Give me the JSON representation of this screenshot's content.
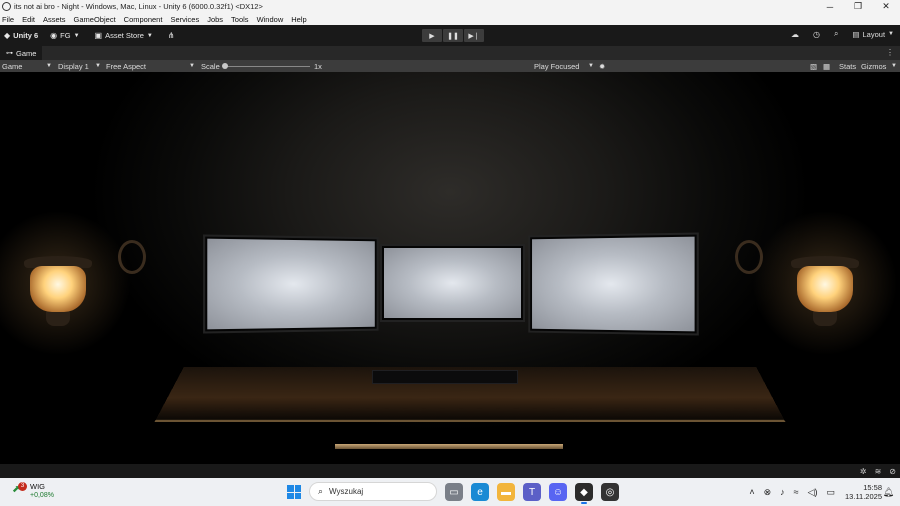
{
  "window": {
    "title": "its not ai bro - Night - Windows, Mac, Linux - Unity 6 (6000.0.32f1) <DX12>",
    "controls": [
      "─",
      "❐",
      "✕"
    ]
  },
  "menu": [
    "File",
    "Edit",
    "Assets",
    "GameObject",
    "Component",
    "Services",
    "Jobs",
    "Tools",
    "Window",
    "Help"
  ],
  "toolbar": {
    "unity_label": "Unity 6",
    "account_label": "FG",
    "asset_store_label": "Asset Store",
    "layout_label": "Layout",
    "play_icons": [
      "▶",
      "❚❚",
      "▶❘"
    ]
  },
  "tab": {
    "game_label": "Game"
  },
  "game_bar": {
    "view_select": "Game",
    "display_select": "Display 1",
    "aspect_select": "Free Aspect",
    "scale_label": "Scale",
    "scale_value": "1x",
    "scale_fraction": 0.0,
    "play_mode_select": "Play Focused",
    "stats_label": "Stats",
    "gizmos_label": "Gizmos"
  },
  "taskbar": {
    "weather_name": "WIG",
    "weather_change": "+0,08%",
    "weather_badge": "3",
    "search_placeholder": "Wyszukaj",
    "time": "15:58",
    "date": "13.11.2025"
  },
  "colors": {
    "editor_bg": "#191919",
    "game_bar_bg": "#3c3c3c",
    "taskbar_bg": "#eef0f3",
    "start_blue": "#1e88e5"
  }
}
